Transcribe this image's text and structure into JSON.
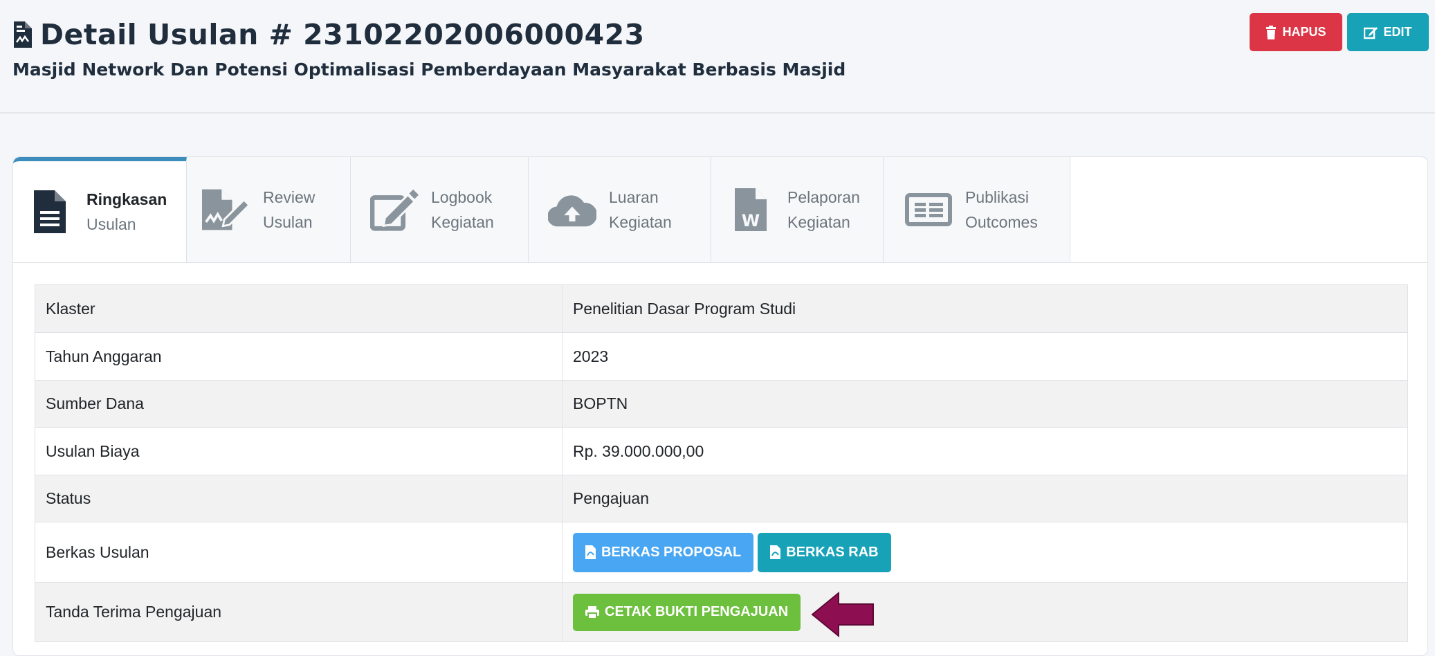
{
  "header": {
    "title": "Detail Usulan # 231022020060004​23",
    "subtitle": "Masjid Network Dan Potensi Optimalisasi Pemberdayaan Masyarakat Berbasis Masjid",
    "hapus_label": "HAPUS",
    "edit_label": "EDIT"
  },
  "tabs": [
    {
      "line1": "Ringkasan",
      "line2": "Usulan",
      "icon": "file-text-icon",
      "active": true
    },
    {
      "line1": "Review",
      "line2": "Usulan",
      "icon": "file-signature-icon",
      "active": false
    },
    {
      "line1": "Logbook",
      "line2": "Kegiatan",
      "icon": "edit-icon",
      "active": false
    },
    {
      "line1": "Luaran",
      "line2": "Kegiatan",
      "icon": "cloud-upload-icon",
      "active": false
    },
    {
      "line1": "Pelaporan",
      "line2": "Kegiatan",
      "icon": "file-word-icon",
      "active": false
    },
    {
      "line1": "Publikasi",
      "line2": "Outcomes",
      "icon": "newspaper-icon",
      "active": false
    }
  ],
  "table": {
    "rows": [
      {
        "label": "Klaster",
        "value": "Penelitian Dasar Program Studi"
      },
      {
        "label": "Tahun Anggaran",
        "value": "2023"
      },
      {
        "label": "Sumber Dana",
        "value": "BOPTN"
      },
      {
        "label": "Usulan Biaya",
        "value": "Rp. 39.000.000,00"
      },
      {
        "label": "Status",
        "value": "Pengajuan"
      },
      {
        "label": "Berkas Usulan",
        "buttons": [
          "BERKAS PROPOSAL",
          "BERKAS RAB"
        ]
      },
      {
        "label": "Tanda Terima Pengajuan",
        "buttons": [
          "CETAK BUKTI PENGAJUAN"
        ]
      }
    ]
  },
  "colors": {
    "danger": "#dc3545",
    "info": "#17a2b8",
    "primary": "#48a6f2",
    "success": "#6dbf3e",
    "arrow": "#8e0e52",
    "tab_active_border": "#3c8dbc"
  }
}
